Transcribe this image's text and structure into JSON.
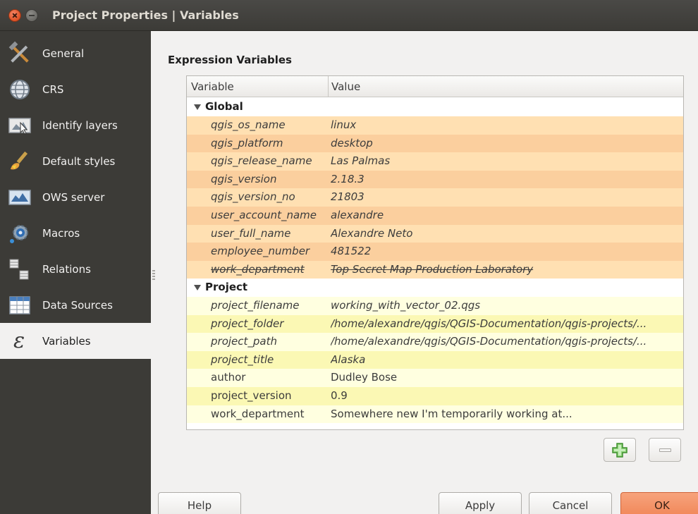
{
  "window": {
    "title": "Project Properties | Variables"
  },
  "sidebar": {
    "items": [
      {
        "label": "General",
        "icon": "wrench-hammer-icon"
      },
      {
        "label": "CRS",
        "icon": "globe-icon"
      },
      {
        "label": "Identify layers",
        "icon": "identify-cursor-icon"
      },
      {
        "label": "Default styles",
        "icon": "paintbrush-icon"
      },
      {
        "label": "OWS server",
        "icon": "ows-server-icon"
      },
      {
        "label": "Macros",
        "icon": "gear-macro-icon"
      },
      {
        "label": "Relations",
        "icon": "relations-icon"
      },
      {
        "label": "Data Sources",
        "icon": "table-icon"
      },
      {
        "label": "Variables",
        "icon": "epsilon-icon",
        "active": true
      }
    ]
  },
  "main": {
    "section_title": "Expression Variables",
    "columns": [
      "Variable",
      "Value"
    ],
    "groups": [
      {
        "name": "Global",
        "rows": [
          {
            "variable": "qgis_os_name",
            "value": "linux"
          },
          {
            "variable": "qgis_platform",
            "value": "desktop"
          },
          {
            "variable": "qgis_release_name",
            "value": "Las Palmas"
          },
          {
            "variable": "qgis_version",
            "value": "2.18.3"
          },
          {
            "variable": "qgis_version_no",
            "value": "21803"
          },
          {
            "variable": "user_account_name",
            "value": "alexandre"
          },
          {
            "variable": "user_full_name",
            "value": "Alexandre Neto"
          },
          {
            "variable": "employee_number",
            "value": "481522"
          },
          {
            "variable": "work_department",
            "value": "Top Secret Map Production Laboratory",
            "overridden": true
          }
        ]
      },
      {
        "name": "Project",
        "rows": [
          {
            "variable": "project_filename",
            "value": "working_with_vector_02.qgs"
          },
          {
            "variable": "project_folder",
            "value": "/home/alexandre/qgis/QGIS-Documentation/qgis-projects/..."
          },
          {
            "variable": "project_path",
            "value": "/home/alexandre/qgis/QGIS-Documentation/qgis-projects/..."
          },
          {
            "variable": "project_title",
            "value": "Alaska"
          },
          {
            "variable": "author",
            "value": "Dudley Bose"
          },
          {
            "variable": "project_version",
            "value": "0.9"
          },
          {
            "variable": "work_department",
            "value": "Somewhere new I'm temporarily working at..."
          }
        ]
      }
    ]
  },
  "buttons": {
    "help": "Help",
    "apply": "Apply",
    "cancel": "Cancel",
    "ok": "OK"
  },
  "colors": {
    "sidebar_bg": "#3c3b37",
    "global_row": "#ffe0b2",
    "project_row": "#ffffe0",
    "ok_button": "#f08354"
  }
}
